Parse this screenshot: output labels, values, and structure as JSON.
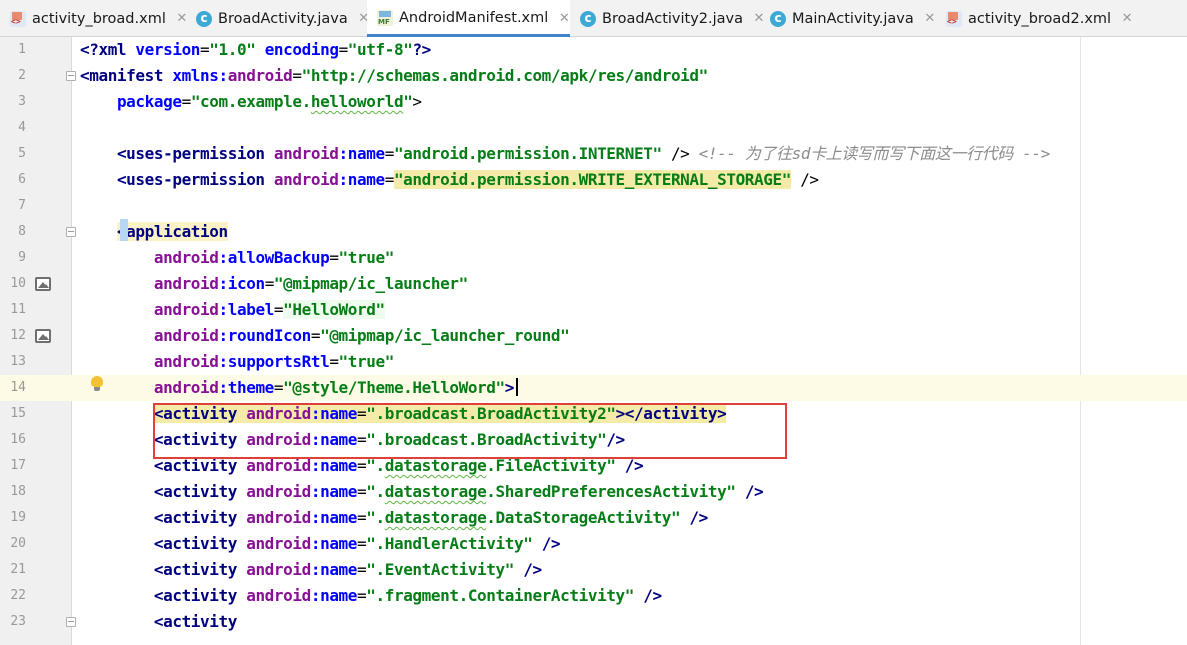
{
  "tabs": [
    {
      "label": "activity_broad.xml",
      "icon": "xml-file-icon",
      "active": false
    },
    {
      "label": "BroadActivity.java",
      "icon": "java-class-icon",
      "active": false
    },
    {
      "label": "AndroidManifest.xml",
      "icon": "manifest-file-icon",
      "active": true
    },
    {
      "label": "BroadActivity2.java",
      "icon": "java-class-icon",
      "active": false
    },
    {
      "label": "MainActivity.java",
      "icon": "java-class-icon",
      "active": false
    },
    {
      "label": "activity_broad2.xml",
      "icon": "xml-file-icon",
      "active": false
    }
  ],
  "tab_close_glyph": "✕",
  "editor": {
    "current_line": 14,
    "highlight_box_lines": [
      15,
      16
    ],
    "highlight_box_color": "#e0403a",
    "lines": [
      {
        "n": "1",
        "tokens": [
          {
            "c": "t-pi",
            "t": "<?xml "
          },
          {
            "c": "t-attr",
            "t": "version"
          },
          {
            "c": "t-punc",
            "t": "="
          },
          {
            "c": "t-val",
            "t": "\"1.0\""
          },
          {
            "c": "t-punc",
            "t": " "
          },
          {
            "c": "t-attr",
            "t": "encoding"
          },
          {
            "c": "t-punc",
            "t": "="
          },
          {
            "c": "t-val",
            "t": "\"utf-8\""
          },
          {
            "c": "t-pi",
            "t": "?>"
          }
        ]
      },
      {
        "n": "2",
        "tokens": [
          {
            "c": "t-tag",
            "t": "<manifest "
          },
          {
            "c": "t-attr",
            "t": "xmlns:"
          },
          {
            "c": "t-ns",
            "t": "android"
          },
          {
            "c": "t-punc",
            "t": "="
          },
          {
            "c": "t-val",
            "t": "\"http://schemas.android.com/apk/res/android\""
          }
        ]
      },
      {
        "n": "3",
        "tokens": [
          {
            "c": "t-punc",
            "t": "    "
          },
          {
            "c": "t-attr",
            "t": "package"
          },
          {
            "c": "t-punc",
            "t": "="
          },
          {
            "c": "t-val",
            "t": "\"com.example."
          },
          {
            "c": "t-val squig",
            "t": "helloworld"
          },
          {
            "c": "t-val",
            "t": "\""
          },
          {
            "c": "t-punc",
            "t": ">"
          }
        ]
      },
      {
        "n": "4",
        "tokens": []
      },
      {
        "n": "5",
        "tokens": [
          {
            "c": "t-punc",
            "t": "    "
          },
          {
            "c": "t-tag",
            "t": "<uses-permission "
          },
          {
            "c": "t-ns",
            "t": "android"
          },
          {
            "c": "t-attr",
            "t": ":name"
          },
          {
            "c": "t-punc",
            "t": "="
          },
          {
            "c": "t-val",
            "t": "\"android.permission.INTERNET\""
          },
          {
            "c": "t-punc",
            "t": " /> "
          },
          {
            "c": "t-cmt",
            "t": "<!-- 为了往sd卡上读写而写下面这一行代码 -->"
          }
        ]
      },
      {
        "n": "6",
        "tokens": [
          {
            "c": "t-punc",
            "t": "    "
          },
          {
            "c": "t-tag",
            "t": "<uses-permission "
          },
          {
            "c": "t-ns",
            "t": "android"
          },
          {
            "c": "t-attr",
            "t": ":name"
          },
          {
            "c": "t-punc",
            "t": "="
          },
          {
            "c": "t-val hl-yellow",
            "t": "\"android.permission.WRITE_EXTERNAL_STORAGE\""
          },
          {
            "c": "t-punc",
            "t": " />"
          }
        ]
      },
      {
        "n": "7",
        "tokens": []
      },
      {
        "n": "8",
        "tokens": [
          {
            "c": "t-punc",
            "t": "    "
          },
          {
            "c": "t-tag hl-tag",
            "t": "<application"
          }
        ]
      },
      {
        "n": "9",
        "tokens": [
          {
            "c": "t-punc",
            "t": "        "
          },
          {
            "c": "t-ns",
            "t": "android"
          },
          {
            "c": "t-attr",
            "t": ":allowBackup"
          },
          {
            "c": "t-punc",
            "t": "="
          },
          {
            "c": "t-val",
            "t": "\"true\""
          }
        ]
      },
      {
        "n": "10",
        "tokens": [
          {
            "c": "t-punc",
            "t": "        "
          },
          {
            "c": "t-ns",
            "t": "android"
          },
          {
            "c": "t-attr",
            "t": ":icon"
          },
          {
            "c": "t-punc",
            "t": "="
          },
          {
            "c": "t-val",
            "t": "\"@mipmap/ic_launcher\""
          }
        ]
      },
      {
        "n": "11",
        "tokens": [
          {
            "c": "t-punc",
            "t": "        "
          },
          {
            "c": "t-ns",
            "t": "android"
          },
          {
            "c": "t-attr",
            "t": ":label"
          },
          {
            "c": "t-punc",
            "t": "="
          },
          {
            "c": "t-val hl-green",
            "t": "\"HelloWord\""
          }
        ]
      },
      {
        "n": "12",
        "tokens": [
          {
            "c": "t-punc",
            "t": "        "
          },
          {
            "c": "t-ns",
            "t": "android"
          },
          {
            "c": "t-attr",
            "t": ":roundIcon"
          },
          {
            "c": "t-punc",
            "t": "="
          },
          {
            "c": "t-val",
            "t": "\"@mipmap/ic_launcher_round\""
          }
        ]
      },
      {
        "n": "13",
        "tokens": [
          {
            "c": "t-punc",
            "t": "        "
          },
          {
            "c": "t-ns",
            "t": "android"
          },
          {
            "c": "t-attr",
            "t": ":supportsRtl"
          },
          {
            "c": "t-punc",
            "t": "="
          },
          {
            "c": "t-val",
            "t": "\"true\""
          }
        ]
      },
      {
        "n": "14",
        "tokens": [
          {
            "c": "t-punc",
            "t": "        "
          },
          {
            "c": "t-ns",
            "t": "android"
          },
          {
            "c": "t-attr",
            "t": ":theme"
          },
          {
            "c": "t-punc",
            "t": "="
          },
          {
            "c": "t-val",
            "t": "\"@style/Theme.HelloWord\""
          },
          {
            "c": "t-tag",
            "t": ">"
          }
        ]
      },
      {
        "n": "15",
        "tokens": [
          {
            "c": "t-punc",
            "t": "        "
          },
          {
            "c": "t-tag hl-yellow",
            "t": "<activity "
          },
          {
            "c": "t-ns hl-yellow",
            "t": "android"
          },
          {
            "c": "t-attr hl-yellow",
            "t": ":name"
          },
          {
            "c": "t-punc hl-yellow",
            "t": "="
          },
          {
            "c": "t-val hl-yellow",
            "t": "\".broadcast.BroadActivity2\""
          },
          {
            "c": "t-tag hl-yellow",
            "t": "></activity>"
          }
        ]
      },
      {
        "n": "16",
        "tokens": [
          {
            "c": "t-punc",
            "t": "        "
          },
          {
            "c": "t-tag",
            "t": "<activity "
          },
          {
            "c": "t-ns",
            "t": "android"
          },
          {
            "c": "t-attr",
            "t": ":name"
          },
          {
            "c": "t-punc",
            "t": "="
          },
          {
            "c": "t-val",
            "t": "\".broadcast.BroadActivity\""
          },
          {
            "c": "t-tag",
            "t": "/>"
          }
        ]
      },
      {
        "n": "17",
        "tokens": [
          {
            "c": "t-punc",
            "t": "        "
          },
          {
            "c": "t-tag",
            "t": "<activity "
          },
          {
            "c": "t-ns",
            "t": "android"
          },
          {
            "c": "t-attr",
            "t": ":name"
          },
          {
            "c": "t-punc",
            "t": "="
          },
          {
            "c": "t-val",
            "t": "\"."
          },
          {
            "c": "t-val squig",
            "t": "datastorage"
          },
          {
            "c": "t-val",
            "t": ".FileActivity\""
          },
          {
            "c": "t-tag",
            "t": " />"
          }
        ]
      },
      {
        "n": "18",
        "tokens": [
          {
            "c": "t-punc",
            "t": "        "
          },
          {
            "c": "t-tag",
            "t": "<activity "
          },
          {
            "c": "t-ns",
            "t": "android"
          },
          {
            "c": "t-attr",
            "t": ":name"
          },
          {
            "c": "t-punc",
            "t": "="
          },
          {
            "c": "t-val",
            "t": "\"."
          },
          {
            "c": "t-val squig",
            "t": "datastorage"
          },
          {
            "c": "t-val",
            "t": ".SharedPreferencesActivity\""
          },
          {
            "c": "t-tag",
            "t": " />"
          }
        ]
      },
      {
        "n": "19",
        "tokens": [
          {
            "c": "t-punc",
            "t": "        "
          },
          {
            "c": "t-tag",
            "t": "<activity "
          },
          {
            "c": "t-ns",
            "t": "android"
          },
          {
            "c": "t-attr",
            "t": ":name"
          },
          {
            "c": "t-punc",
            "t": "="
          },
          {
            "c": "t-val",
            "t": "\"."
          },
          {
            "c": "t-val squig",
            "t": "datastorage"
          },
          {
            "c": "t-val",
            "t": ".DataStorageActivity\""
          },
          {
            "c": "t-tag",
            "t": " />"
          }
        ]
      },
      {
        "n": "20",
        "tokens": [
          {
            "c": "t-punc",
            "t": "        "
          },
          {
            "c": "t-tag",
            "t": "<activity "
          },
          {
            "c": "t-ns",
            "t": "android"
          },
          {
            "c": "t-attr",
            "t": ":name"
          },
          {
            "c": "t-punc",
            "t": "="
          },
          {
            "c": "t-val",
            "t": "\".HandlerActivity\""
          },
          {
            "c": "t-tag",
            "t": " />"
          }
        ]
      },
      {
        "n": "21",
        "tokens": [
          {
            "c": "t-punc",
            "t": "        "
          },
          {
            "c": "t-tag",
            "t": "<activity "
          },
          {
            "c": "t-ns",
            "t": "android"
          },
          {
            "c": "t-attr",
            "t": ":name"
          },
          {
            "c": "t-punc",
            "t": "="
          },
          {
            "c": "t-val",
            "t": "\".EventActivity\""
          },
          {
            "c": "t-tag",
            "t": " />"
          }
        ]
      },
      {
        "n": "22",
        "tokens": [
          {
            "c": "t-punc",
            "t": "        "
          },
          {
            "c": "t-tag",
            "t": "<activity "
          },
          {
            "c": "t-ns",
            "t": "android"
          },
          {
            "c": "t-attr",
            "t": ":name"
          },
          {
            "c": "t-punc",
            "t": "="
          },
          {
            "c": "t-val",
            "t": "\".fragment.ContainerActivity\""
          },
          {
            "c": "t-tag",
            "t": " />"
          }
        ]
      },
      {
        "n": "23",
        "tokens": [
          {
            "c": "t-punc",
            "t": "        "
          },
          {
            "c": "t-tag",
            "t": "<activity"
          }
        ]
      }
    ]
  }
}
